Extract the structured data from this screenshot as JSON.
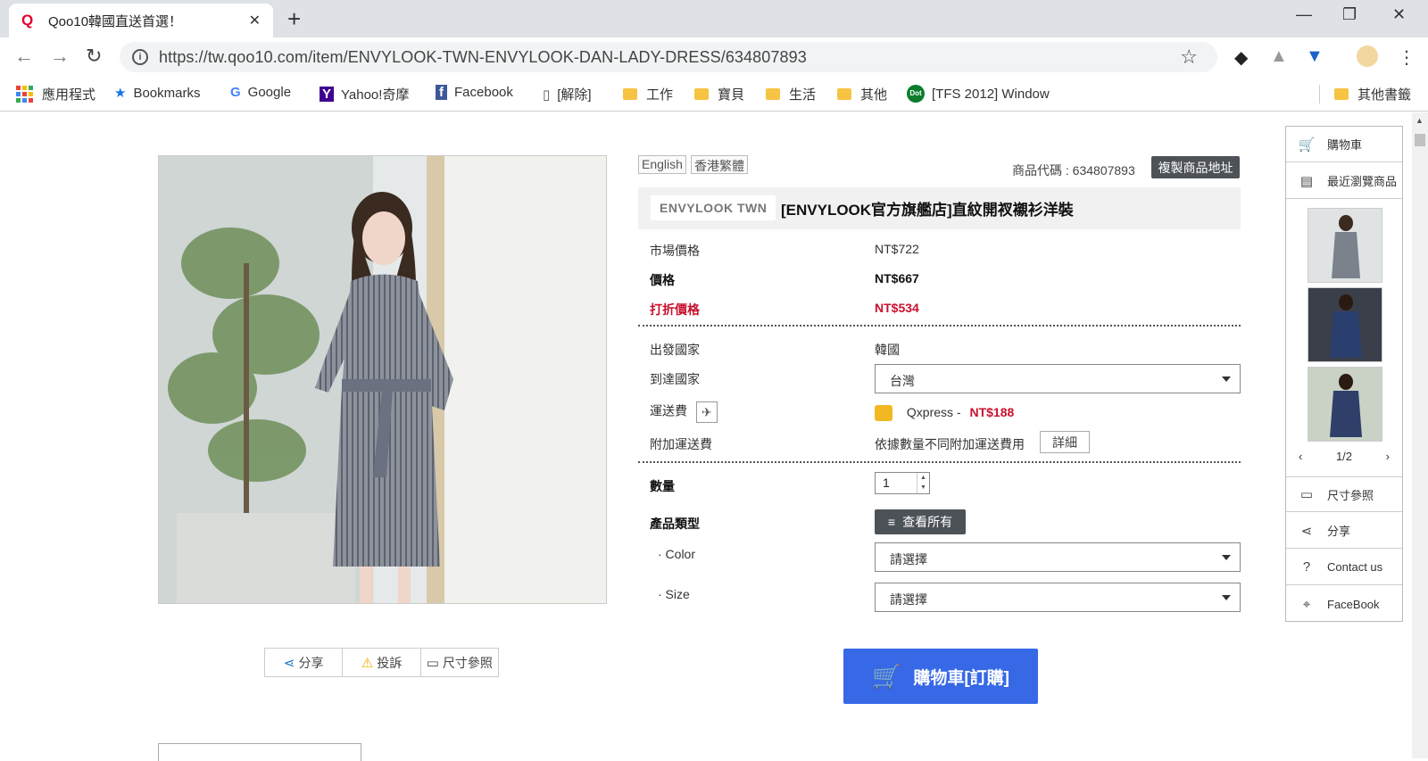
{
  "browser": {
    "tab_title": "Qoo10韓國直送首選！",
    "tab_favicon": "Q",
    "url": "https://tw.qoo10.com/item/ENVYLOOK-TWN-ENVYLOOK-DAN-LADY-DRESS/634807893",
    "bookmarks": [
      {
        "label": "應用程式",
        "icon": "apps-grid-icon"
      },
      {
        "label": "Bookmarks",
        "icon": "star-icon"
      },
      {
        "label": "Google",
        "icon": "google-icon"
      },
      {
        "label": "Yahoo!奇摩",
        "icon": "yahoo-icon"
      },
      {
        "label": "Facebook",
        "icon": "facebook-icon"
      },
      {
        "label": "[解除]",
        "icon": "page-icon"
      },
      {
        "label": "工作",
        "icon": "folder-icon"
      },
      {
        "label": "寶貝",
        "icon": "folder-icon"
      },
      {
        "label": "生活",
        "icon": "folder-icon"
      },
      {
        "label": "其他",
        "icon": "folder-icon"
      },
      {
        "label": "[TFS 2012] Window",
        "icon": "dot-icon"
      },
      {
        "label": "其他書籤",
        "icon": "folder-icon"
      }
    ]
  },
  "product": {
    "lang_english": "English",
    "lang_hk": "香港繁體",
    "code_label": "商品代碼 : 634807893",
    "copy_link_label": "複製商品地址",
    "brand": "ENVYLOOK TWN",
    "title": "[ENVYLOOK官方旗艦店]直紋開衩襯衫洋裝",
    "market_price_label": "市場價格",
    "market_price": "NT$722",
    "price_label": "價格",
    "price": "NT$667",
    "discount_label": "打折價格",
    "discount_price": "NT$534",
    "origin_label": "出發國家",
    "origin": "韓國",
    "dest_label": "到達國家",
    "dest": "台灣",
    "shipping_label": "運送費",
    "shipping_method": "Qxpress -",
    "shipping_fee": "NT$188",
    "extra_shipping_label": "附加運送費",
    "extra_shipping_text": "依據數量不同附加運送費用",
    "detail_btn": "詳細",
    "qty_label": "數量",
    "qty_value": "1",
    "type_label": "產品類型",
    "view_all": "查看所有",
    "color_label": "· Color",
    "color_value": "請選擇",
    "size_label": "· Size",
    "size_value": "請選擇",
    "cart_button": "購物車[訂購]"
  },
  "actions": {
    "share": "分享",
    "report": "投訴",
    "size_guide": "尺寸參照"
  },
  "sidebar": {
    "cart": "購物車",
    "recent": "最近瀏覽商品",
    "pager": "1/2",
    "size_guide": "尺寸參照",
    "share": "分享",
    "contact": "Contact us",
    "facebook": "FaceBook"
  },
  "colors": {
    "accent_blue": "#3768e6",
    "discount_red": "#c8102e",
    "dark_button": "#4d5158"
  }
}
